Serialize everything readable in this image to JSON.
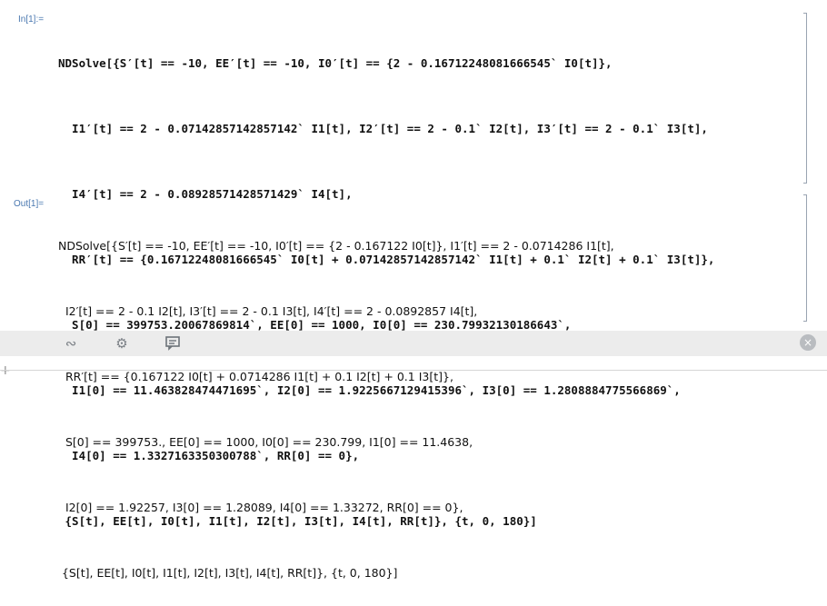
{
  "input_cell": {
    "label": "In[1]:=",
    "lines": [
      "NDSolve[{S′[t] == -10, EE′[t] == -10, I0′[t] == {2 - 0.16712248081666545` I0[t]},",
      "  I1′[t] == 2 - 0.07142857142857142` I1[t], I2′[t] == 2 - 0.1` I2[t], I3′[t] == 2 - 0.1` I3[t],",
      "  I4′[t] == 2 - 0.08928571428571429` I4[t],",
      "  RR′[t] == {0.16712248081666545` I0[t] + 0.07142857142857142` I1[t] + 0.1` I2[t] + 0.1` I3[t]},",
      "  S[0] == 399753.20067869814`, EE[0] == 1000, I0[0] == 230.79932130186643`,",
      "  I1[0] == 11.463828474471695`, I2[0] == 1.9225667129415396`, I3[0] == 1.2808884775566869`,",
      "  I4[0] == 1.3327163350300788`, RR[0] == 0},",
      " {S[t], EE[t], I0[t], I1[t], I2[t], I3[t], I4[t], RR[t]}, {t, 0, 180}]"
    ]
  },
  "output_cell": {
    "label": "Out[1]=",
    "lines": [
      "NDSolve[{S′[t] == -10, EE′[t] == -10, I0′[t] == {2 - 0.167122 I0[t]}, I1′[t] == 2 - 0.0714286 I1[t],",
      "  I2′[t] == 2 - 0.1 I2[t], I3′[t] == 2 - 0.1 I3[t], I4′[t] == 2 - 0.0892857 I4[t],",
      "  RR′[t] == {0.167122 I0[t] + 0.0714286 I1[t] + 0.1 I2[t] + 0.1 I3[t]},",
      "  S[0] == 399753., EE[0] == 1000, I0[0] == 230.799, I1[0] == 11.4638,",
      "  I2[0] == 1.92257, I3[0] == 1.28089, I4[0] == 1.33272, RR[0] == 0},",
      " {S[t], EE[t], I0[t], I1[t], I2[t], I3[t], I4[t], RR[t]}, {t, 0, 180}]"
    ]
  },
  "toolbar": {
    "icons": [
      "swirl-icon",
      "gear-icon",
      "comment-icon",
      "close-icon"
    ]
  },
  "new_cell": {
    "symbol": "+"
  }
}
